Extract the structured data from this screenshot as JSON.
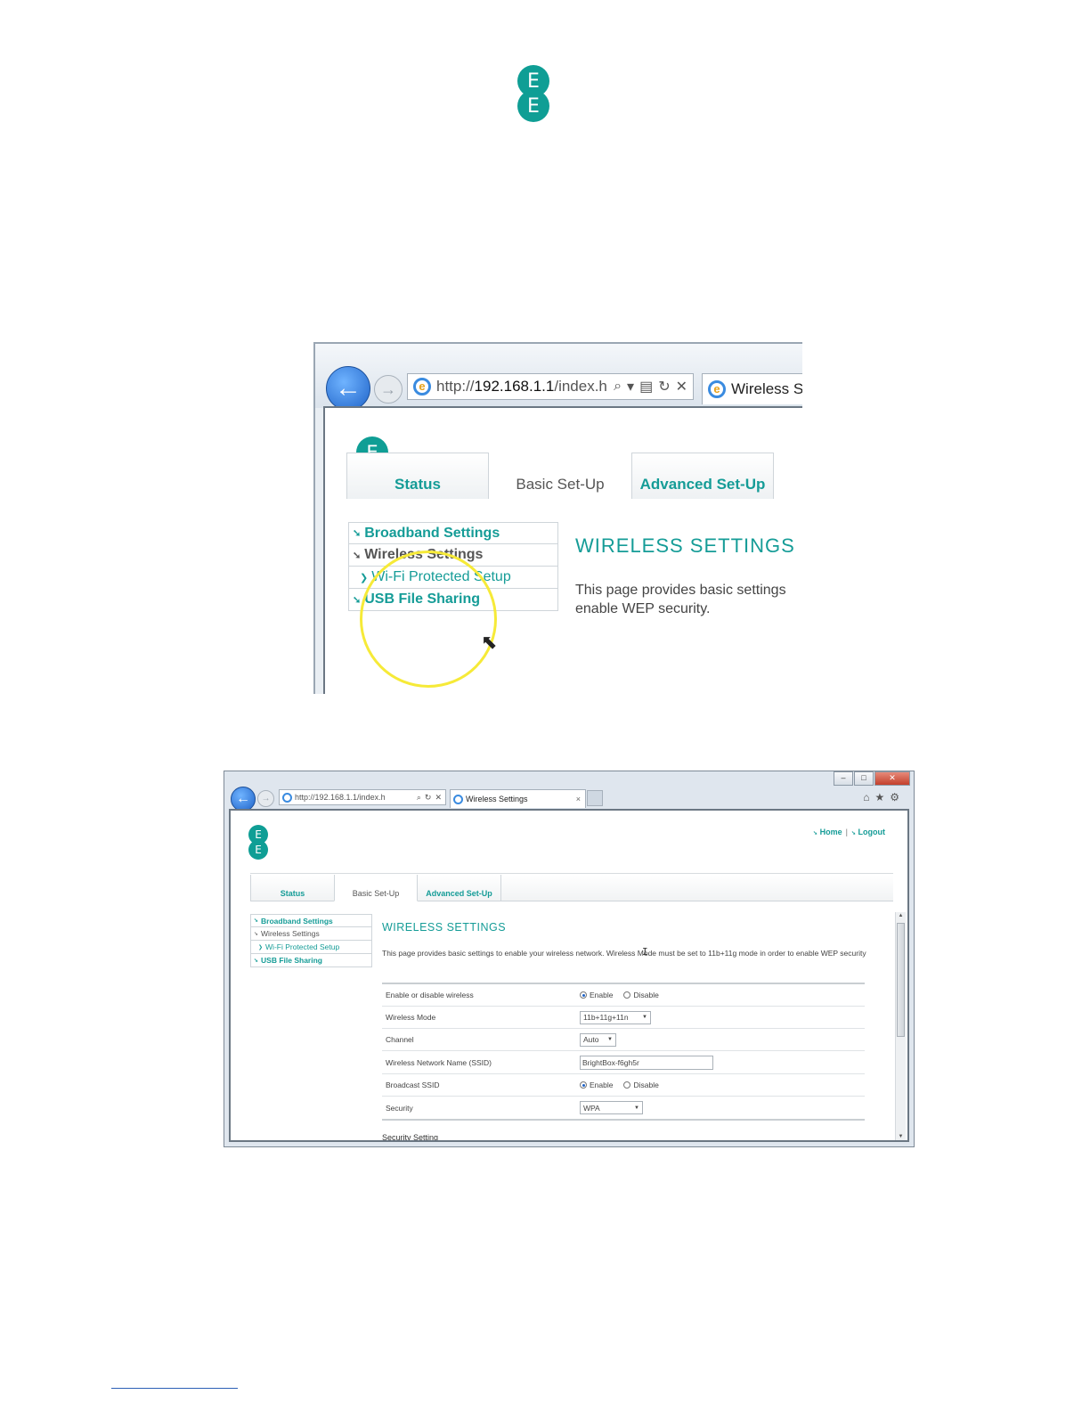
{
  "logo": {
    "letters": [
      "E",
      "E"
    ]
  },
  "shot1": {
    "address": {
      "prefix": "http://",
      "host": "192.168.1.1",
      "path": "/index.h"
    },
    "tab_title": "Wireless Set",
    "tabs": [
      "Status",
      "Basic Set-Up",
      "Advanced Set-Up"
    ],
    "menu": [
      "Broadband Settings",
      "Wireless Settings",
      "Wi-Fi Protected Setup",
      "USB File Sharing"
    ],
    "heading": "WIRELESS SETTINGS",
    "desc_line1": "This page provides basic settings",
    "desc_line2": "enable WEP security."
  },
  "shot2": {
    "window_buttons": {
      "min": "–",
      "max": "□",
      "close": "✕"
    },
    "address": "http://192.168.1.1/index.h",
    "tab_title": "Wireless Settings",
    "tab_close": "×",
    "top_links": [
      "Home",
      "Logout"
    ],
    "tabs": [
      "Status",
      "Basic Set-Up",
      "Advanced Set-Up"
    ],
    "menu": [
      "Broadband Settings",
      "Wireless Settings",
      "Wi-Fi Protected Setup",
      "USB File Sharing"
    ],
    "heading": "WIRELESS SETTINGS",
    "description": "This page provides basic settings to enable your wireless network. Wireless Mode must be set to 11b+11g mode in order to enable WEP security",
    "form": {
      "enable_label": "Enable or disable wireless",
      "mode_label": "Wireless Mode",
      "mode_value": "11b+11g+11n",
      "channel_label": "Channel",
      "channel_value": "Auto",
      "ssid_label": "Wireless Network Name (SSID)",
      "ssid_value": "BrightBox-f6gh5r",
      "broadcast_label": "Broadcast SSID",
      "security_label": "Security",
      "security_value": "WPA",
      "opt_enable": "Enable",
      "opt_disable": "Disable"
    },
    "security_setting": "Security Setting"
  },
  "colors": {
    "brand": "#0f9e95",
    "link": "#159c97"
  }
}
